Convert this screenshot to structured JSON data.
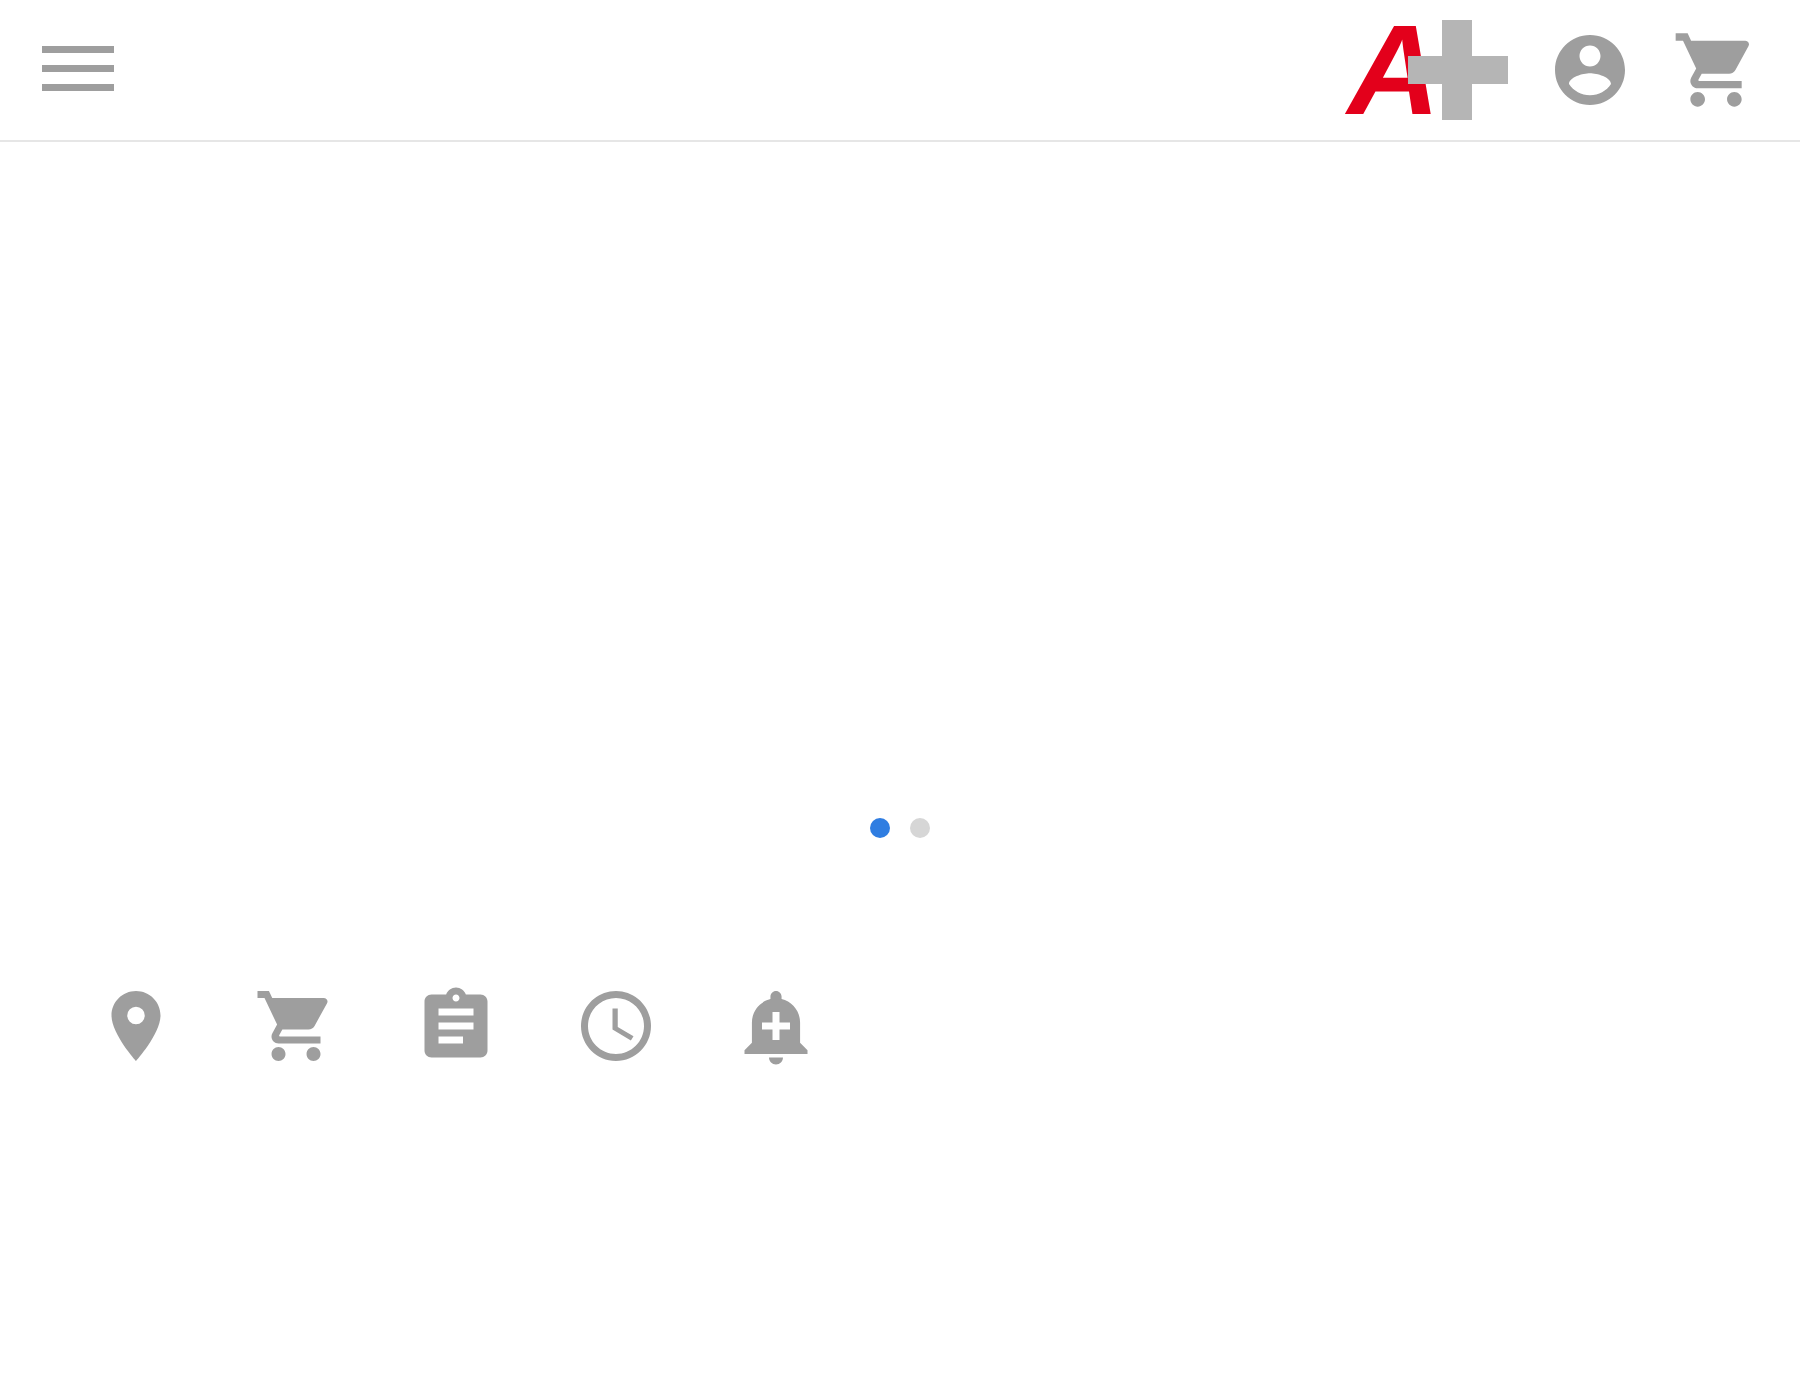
{
  "header": {
    "logo": {
      "letter": "A"
    }
  },
  "carousel": {
    "dots": [
      {
        "selected": true
      },
      {
        "selected": false
      }
    ]
  },
  "shortcuts": [
    {
      "kind": "location"
    },
    {
      "kind": "cart"
    },
    {
      "kind": "clipboard"
    },
    {
      "kind": "clock"
    },
    {
      "kind": "bell-plus"
    }
  ]
}
